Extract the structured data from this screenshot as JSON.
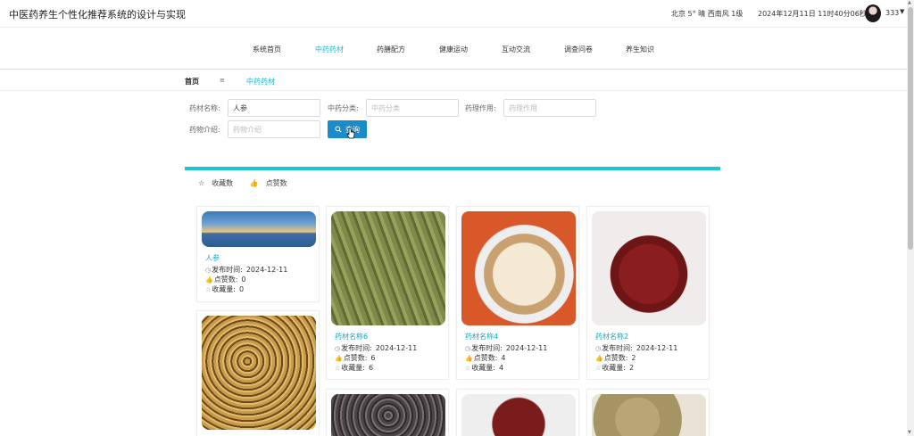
{
  "header": {
    "title": "中医药养生个性化推荐系统的设计与实现",
    "weather": "北京  5°  晴  西南风  1级",
    "datetime": "2024年12月11日 11时40分06秒",
    "username": "333"
  },
  "nav": {
    "items": [
      {
        "label": "系统首页"
      },
      {
        "label": "中药药材"
      },
      {
        "label": "药膳配方"
      },
      {
        "label": "健康运动"
      },
      {
        "label": "互动交流"
      },
      {
        "label": "调查问卷"
      },
      {
        "label": "养生知识"
      }
    ],
    "active_index": 1
  },
  "breadcrumb": {
    "home": "首页",
    "separator": "≡",
    "current": "中药药材"
  },
  "search": {
    "name_label": "药材名称:",
    "name_value": "人参",
    "category_label": "中药分类:",
    "category_placeholder": "中药分类",
    "effect_label": "药理作用:",
    "effect_placeholder": "药理作用",
    "intro_label": "药物介绍:",
    "intro_placeholder": "药物介绍",
    "button_label": "查询"
  },
  "sort": {
    "by_collect": "收藏数",
    "by_like": "点赞数"
  },
  "labels": {
    "publish": "发布时间:",
    "likes": "点赞数:",
    "collects": "收藏量:"
  },
  "cards": [
    {
      "title": "人参",
      "date": "2024-12-11",
      "likes": "0",
      "collects": "0",
      "image": "bridge-landscape"
    },
    {
      "title": "药材名称6",
      "date": "2024-12-11",
      "likes": "6",
      "collects": "6",
      "image": "green-sticks"
    },
    {
      "title": "药材名称4",
      "date": "2024-12-11",
      "likes": "4",
      "collects": "4",
      "image": "herb-slices"
    },
    {
      "title": "药材名称2",
      "date": "2024-12-11",
      "likes": "2",
      "collects": "2",
      "image": "red-blocks"
    },
    {
      "title": "",
      "date": "",
      "likes": "",
      "collects": "",
      "image": "golden-seeds"
    },
    {
      "title": "",
      "date": "",
      "likes": "",
      "collects": "",
      "image": "dark-peppercorns"
    },
    {
      "title": "",
      "date": "",
      "likes": "",
      "collects": "",
      "image": "red-chunks-bowl"
    },
    {
      "title": "",
      "date": "",
      "likes": "",
      "collects": "",
      "image": "herb-powder"
    }
  ],
  "icons": {
    "search": "search-icon",
    "clock": "clock-icon",
    "thumb": "thumb-up-icon",
    "star": "star-icon"
  },
  "colors": {
    "accent": "#1fb7c9",
    "button": "#1a8cc9",
    "bar": "#1fc4d8"
  }
}
